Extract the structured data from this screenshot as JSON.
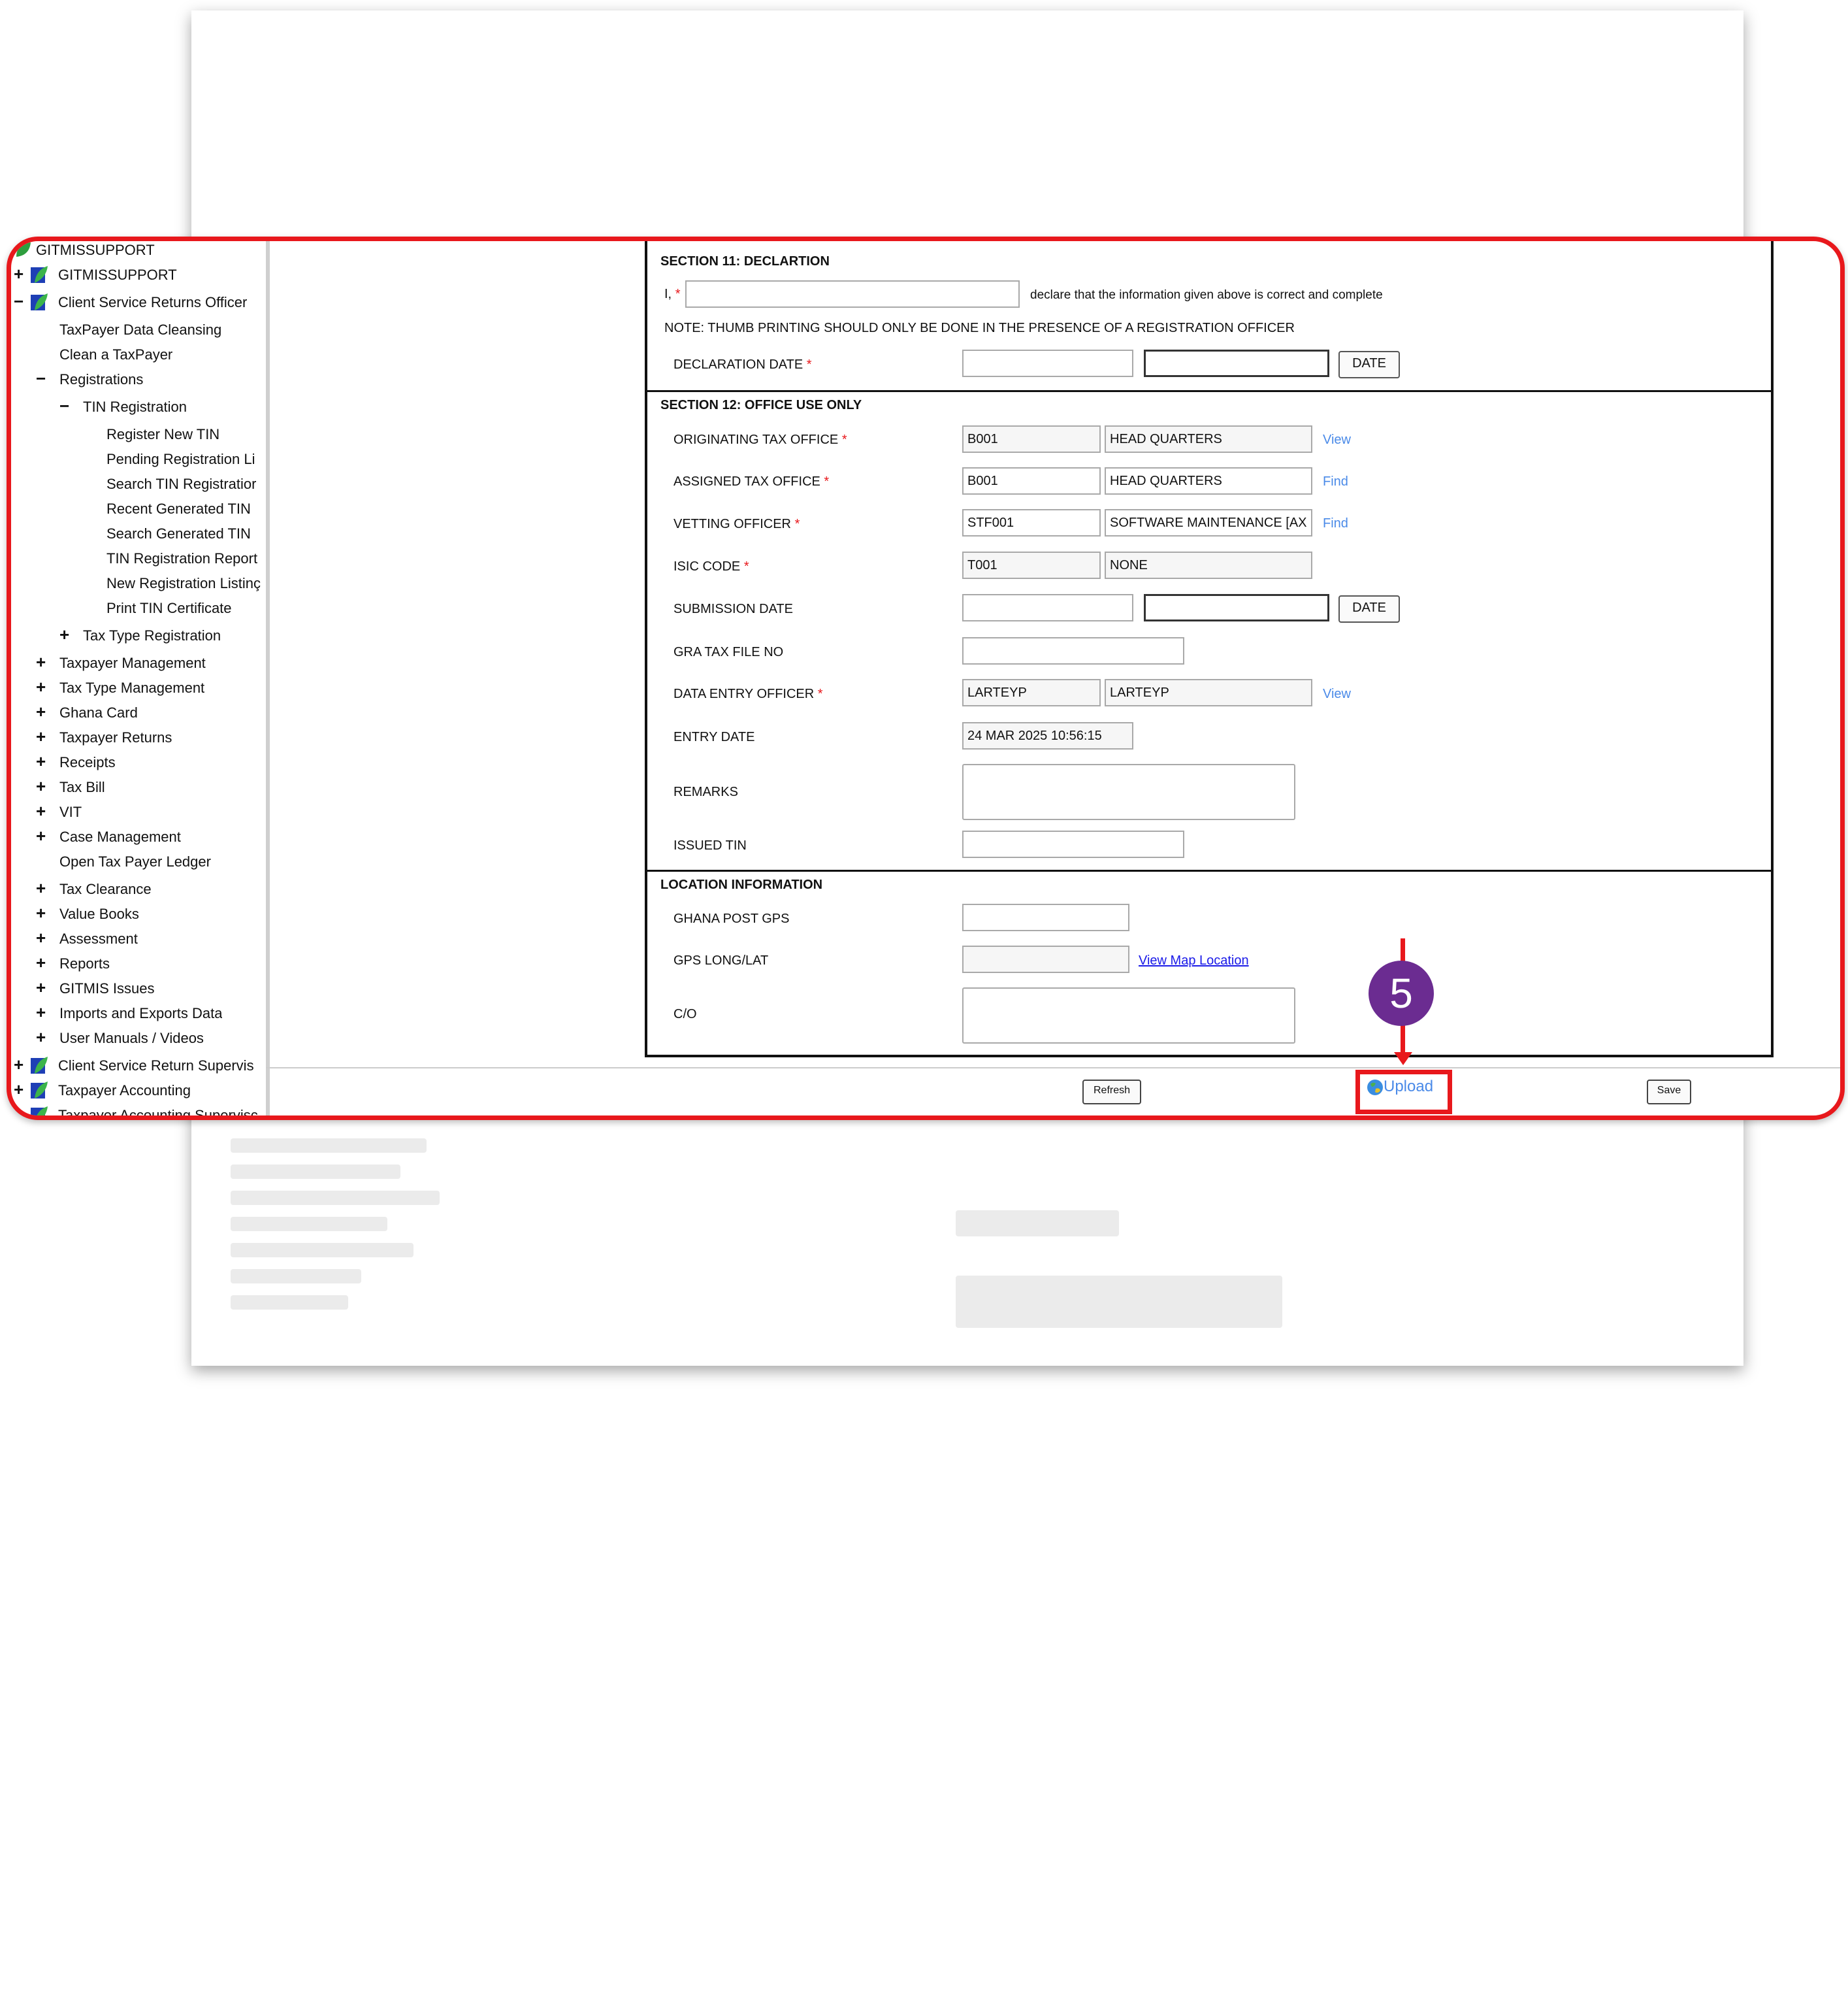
{
  "tree": {
    "items": [
      {
        "label": "GITMISSUPPORT",
        "sign": "",
        "icon": "leaf"
      },
      {
        "label": "GITMISSUPPORT",
        "sign": "+",
        "icon": "folder"
      },
      {
        "label": "Client Service Returns Officer",
        "sign": "−",
        "icon": "folder"
      },
      {
        "label": "TaxPayer Data Cleansing",
        "sign": ""
      },
      {
        "label": "Clean a TaxPayer",
        "sign": ""
      },
      {
        "label": "Registrations",
        "sign": "−"
      },
      {
        "label": "TIN Registration",
        "sign": "−"
      },
      {
        "label": "Register New TIN",
        "sign": ""
      },
      {
        "label": "Pending Registration Li",
        "sign": ""
      },
      {
        "label": "Search TIN Registratior",
        "sign": ""
      },
      {
        "label": "Recent Generated TIN",
        "sign": ""
      },
      {
        "label": "Search Generated TIN",
        "sign": ""
      },
      {
        "label": "TIN Registration Report",
        "sign": ""
      },
      {
        "label": "New Registration Listinç",
        "sign": ""
      },
      {
        "label": "Print TIN Certificate",
        "sign": ""
      },
      {
        "label": "Tax Type Registration",
        "sign": "+"
      },
      {
        "label": "Taxpayer Management",
        "sign": "+"
      },
      {
        "label": "Tax Type Management",
        "sign": "+"
      },
      {
        "label": "Ghana Card",
        "sign": "+"
      },
      {
        "label": "Taxpayer Returns",
        "sign": "+"
      },
      {
        "label": "Receipts",
        "sign": "+"
      },
      {
        "label": "Tax Bill",
        "sign": "+"
      },
      {
        "label": "VIT",
        "sign": "+"
      },
      {
        "label": "Case Management",
        "sign": "+"
      },
      {
        "label": "Open Tax Payer Ledger",
        "sign": ""
      },
      {
        "label": "Tax Clearance",
        "sign": "+"
      },
      {
        "label": "Value Books",
        "sign": "+"
      },
      {
        "label": "Assessment",
        "sign": "+"
      },
      {
        "label": "Reports",
        "sign": "+"
      },
      {
        "label": "GITMIS Issues",
        "sign": "+"
      },
      {
        "label": "Imports and Exports Data",
        "sign": "+"
      },
      {
        "label": "User Manuals / Videos",
        "sign": "+"
      },
      {
        "label": "Client Service Return Supervis",
        "sign": "+",
        "icon": "folder"
      },
      {
        "label": "Taxpayer Accounting",
        "sign": "+",
        "icon": "folder"
      },
      {
        "label": "Taxpayer Accounting Supervisc",
        "sign": "+",
        "icon": "folder"
      }
    ]
  },
  "section11": {
    "title": "SECTION 11: DECLARTION",
    "i_label": "I,",
    "declare_text": "declare that the information given above is correct and complete",
    "note": "NOTE: THUMB PRINTING SHOULD ONLY BE DONE IN THE PRESENCE OF A REGISTRATION OFFICER",
    "declaration_date_label": "DECLARATION DATE",
    "date_button": "DATE"
  },
  "section12": {
    "title": "SECTION 12: OFFICE USE ONLY",
    "originating_label": "ORIGINATING TAX OFFICE",
    "originating_code": "B001",
    "originating_name": "HEAD QUARTERS",
    "originating_link": "View",
    "assigned_label": "ASSIGNED TAX OFFICE",
    "assigned_code": "B001",
    "assigned_name": "HEAD QUARTERS",
    "assigned_link": "Find",
    "vetting_label": "VETTING OFFICER",
    "vetting_code": "STF001",
    "vetting_name": "SOFTWARE MAINTENANCE [AX",
    "vetting_link": "Find",
    "isic_label": "ISIC CODE",
    "isic_code": "T001",
    "isic_name": "NONE",
    "submission_label": "SUBMISSION DATE",
    "date_button": "DATE",
    "gra_label": "GRA TAX FILE NO",
    "data_entry_label": "DATA ENTRY OFFICER",
    "data_entry_code": "LARTEYP",
    "data_entry_name": "LARTEYP",
    "data_entry_link": "View",
    "entry_date_label": "ENTRY DATE",
    "entry_date_value": "24 MAR 2025 10:56:15",
    "remarks_label": "REMARKS",
    "issued_tin_label": "ISSUED TIN"
  },
  "location": {
    "title": "LOCATION INFORMATION",
    "ghana_post_label": "GHANA POST GPS",
    "gps_label": "GPS LONG/LAT",
    "map_link": "View Map Location",
    "co_label": "C/O"
  },
  "footer": {
    "refresh": "Refresh",
    "upload": "Upload",
    "save": "Save"
  },
  "annotation": {
    "step": "5"
  },
  "colors": {
    "highlight": "#e8181c",
    "marker": "#6b2c91",
    "link": "#4a8ae8"
  }
}
